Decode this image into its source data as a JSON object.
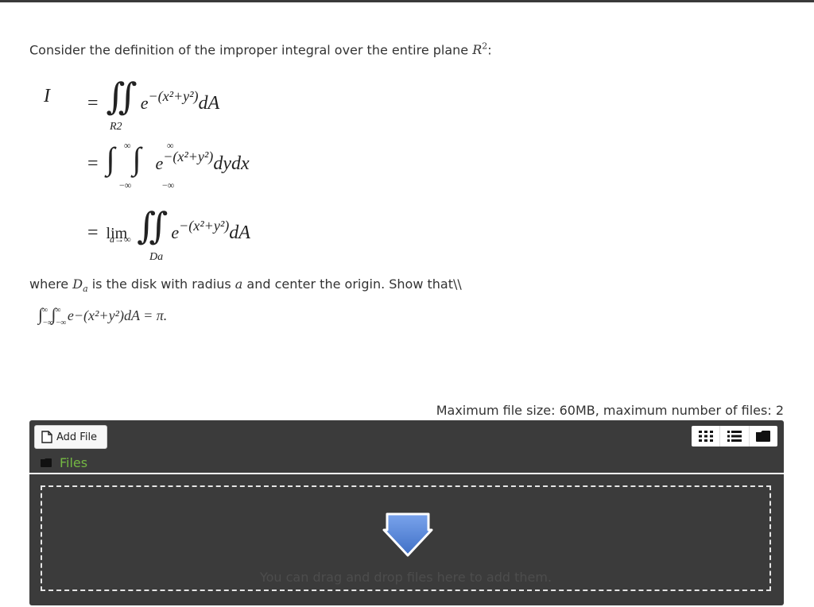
{
  "question": {
    "intro": "Consider the definition of the improper integral over the entire plane ",
    "plane_symbol": "R",
    "plane_exp": "2",
    "intro_end": ":",
    "equations": {
      "lhs": "I",
      "eq": "=",
      "region1": "R2",
      "exponent": "−(x²+y²)",
      "base": "e",
      "dA": "dA",
      "dydx": "dydx",
      "upper": "∞",
      "lower": "−∞",
      "lim": "lim",
      "lim_sub": "a→∞",
      "region3": "Da"
    },
    "where_text_1": "where ",
    "where_symbol": "D",
    "where_sub": "a",
    "where_text_2": " is the disk with radius ",
    "where_radius": "a",
    "where_text_3": " and center the origin. Show that\\\\",
    "show_expr": "e−(x²+y²)dA = π."
  },
  "uploader": {
    "max_info": "Maximum file size: 60MB, maximum number of files: 2",
    "add_file_label": "Add File",
    "files_label": "Files",
    "drop_text": "You can drag and drop files here to add them.",
    "icons": {
      "add_file": "document-icon",
      "files": "folder-icon",
      "view_grid": "grid-view-icon",
      "view_list": "list-view-icon",
      "view_tree": "folder-view-icon",
      "drop": "download-arrow-icon"
    },
    "colors": {
      "panel": "#3b3b3b",
      "files_label": "#74b843",
      "arrow": "#5b87d6"
    }
  }
}
